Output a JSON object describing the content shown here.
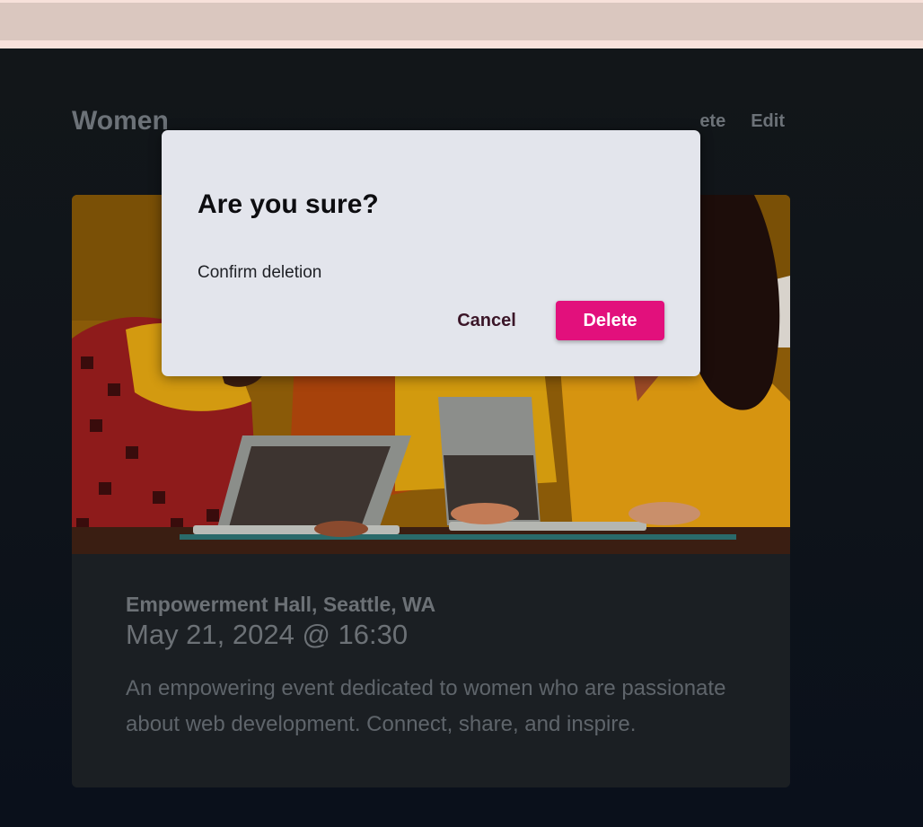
{
  "page": {
    "title": "Women",
    "actions": {
      "delete_label": "ete",
      "edit_label": "Edit"
    }
  },
  "event": {
    "image_alt": "Illustration of women working together on laptops",
    "venue": "Empowerment Hall, Seattle, WA",
    "datetime": "May 21, 2024 @ 16:30",
    "description": "An empowering event dedicated to women who are passionate about web development. Connect, share, and inspire."
  },
  "dialog": {
    "title": "Are you sure?",
    "message": "Confirm deletion",
    "cancel_label": "Cancel",
    "confirm_label": "Delete"
  },
  "colors": {
    "accent": "#e2107c",
    "top_band": "#dac7bf",
    "background": "#0b1019",
    "card": "#1b1f23",
    "modal": "#e3e5ec"
  }
}
